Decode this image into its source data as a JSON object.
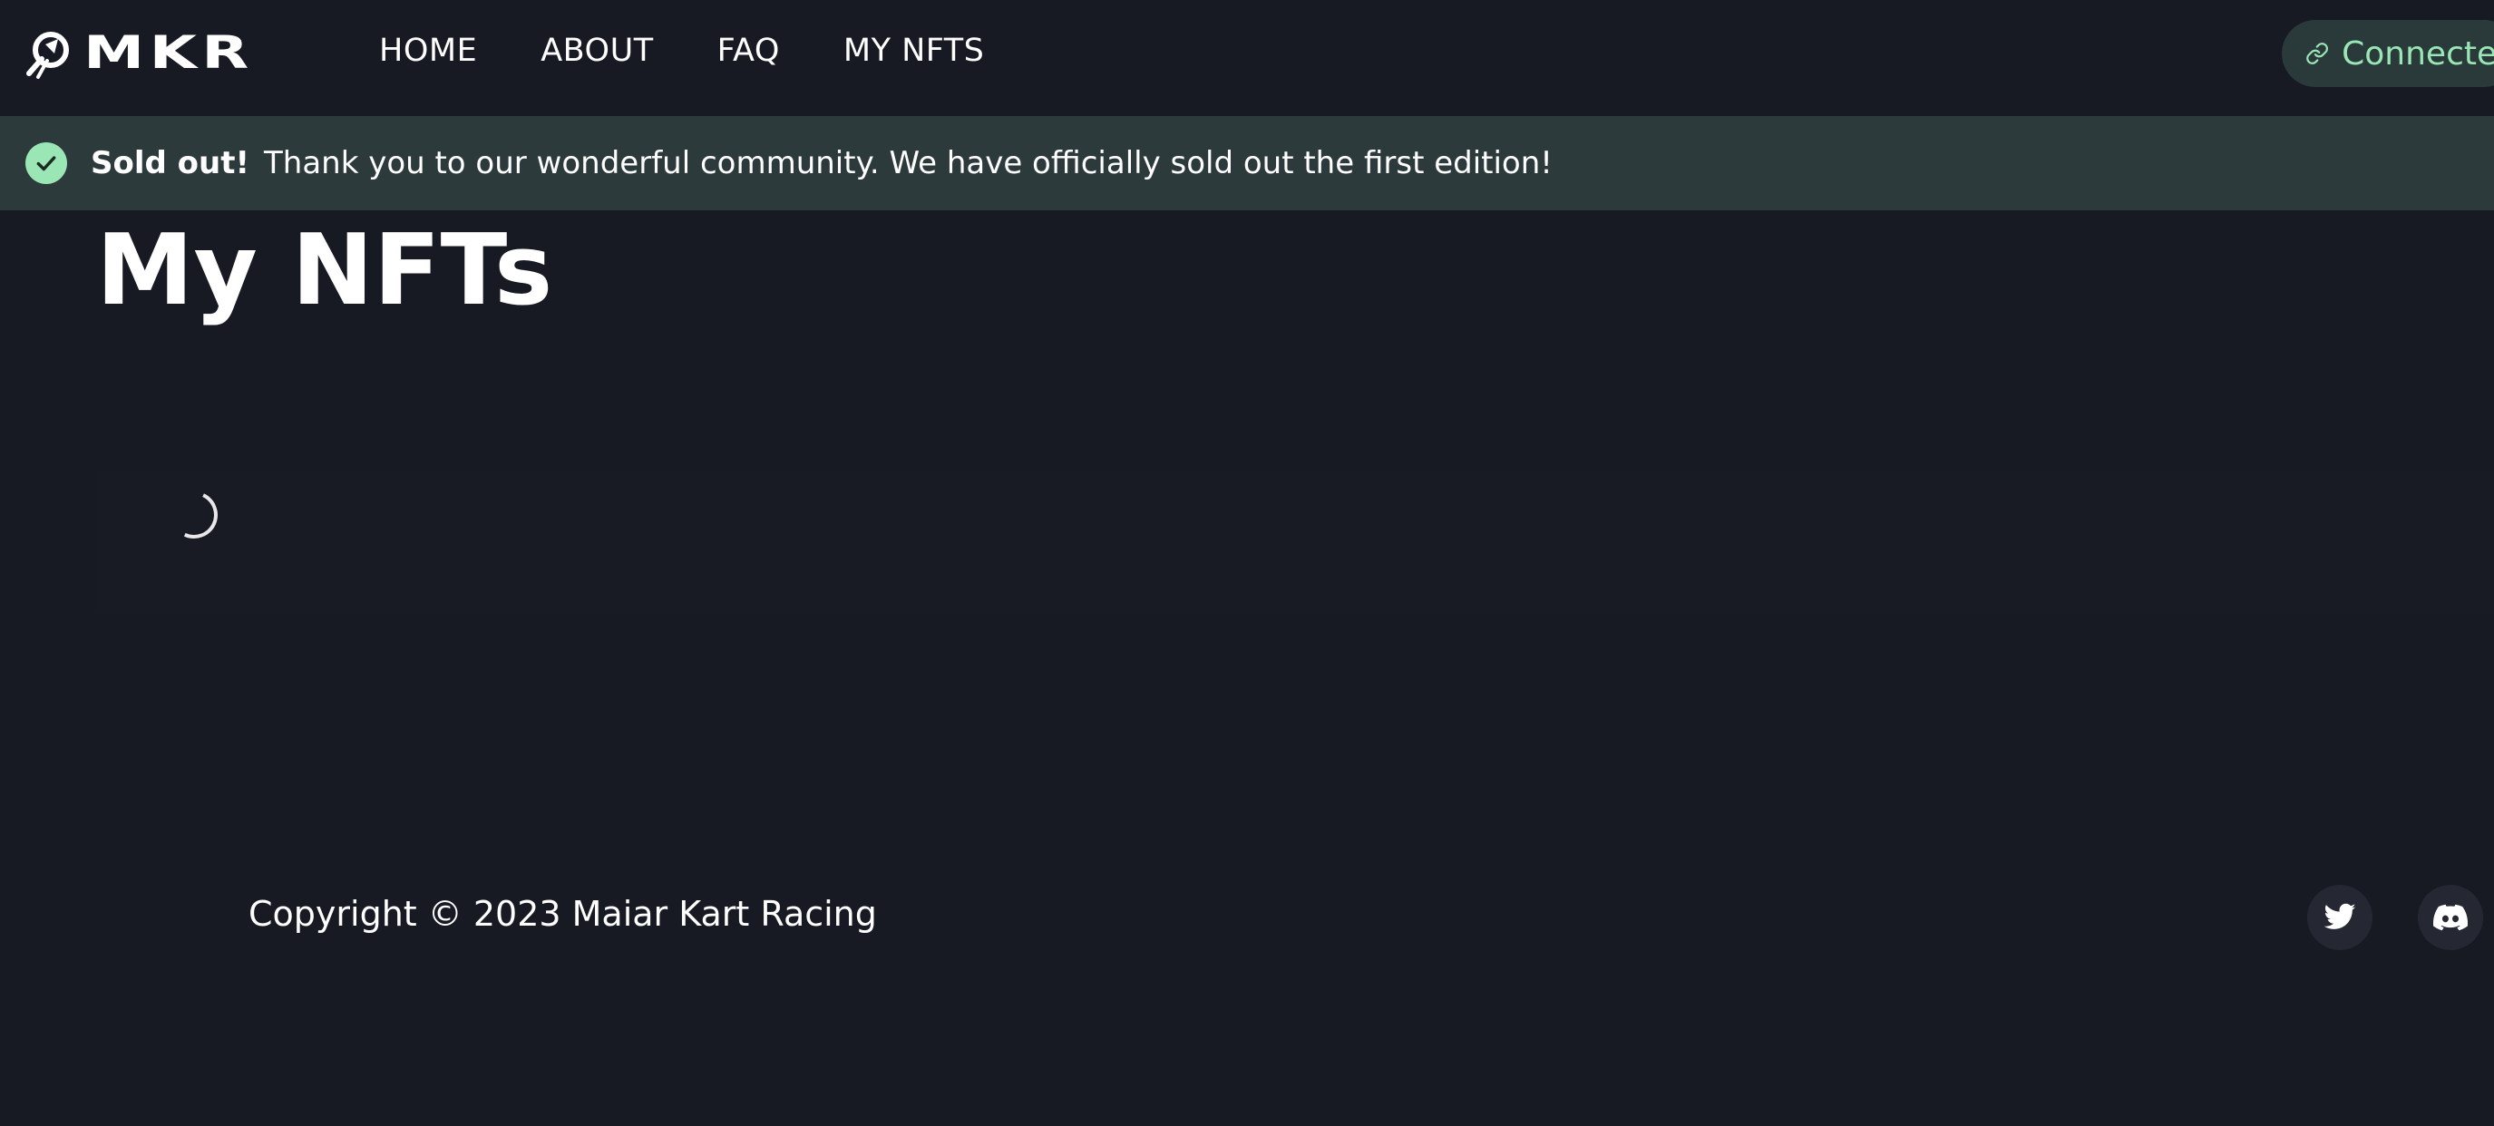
{
  "nav": {
    "logo_text": "MKR",
    "links": [
      "HOME",
      "ABOUT",
      "FAQ",
      "MY NFTS"
    ],
    "connect_label": "Connected"
  },
  "alert": {
    "title": "Sold out!",
    "description": "Thank you to our wonderful community. We have officially sold out the first edition!",
    "icon": "check-circle-icon",
    "accent_color": "#9ae6b4"
  },
  "main": {
    "title": "My NFTs",
    "loading_icon": "spinner-icon"
  },
  "footer": {
    "copyright": "Copyright © 2023 Maiar Kart Racing",
    "social": [
      "twitter-icon",
      "discord-icon"
    ]
  },
  "colors": {
    "background": "#171923",
    "alert_bg": "#2d3a3b",
    "accent": "#9ae6b4"
  }
}
